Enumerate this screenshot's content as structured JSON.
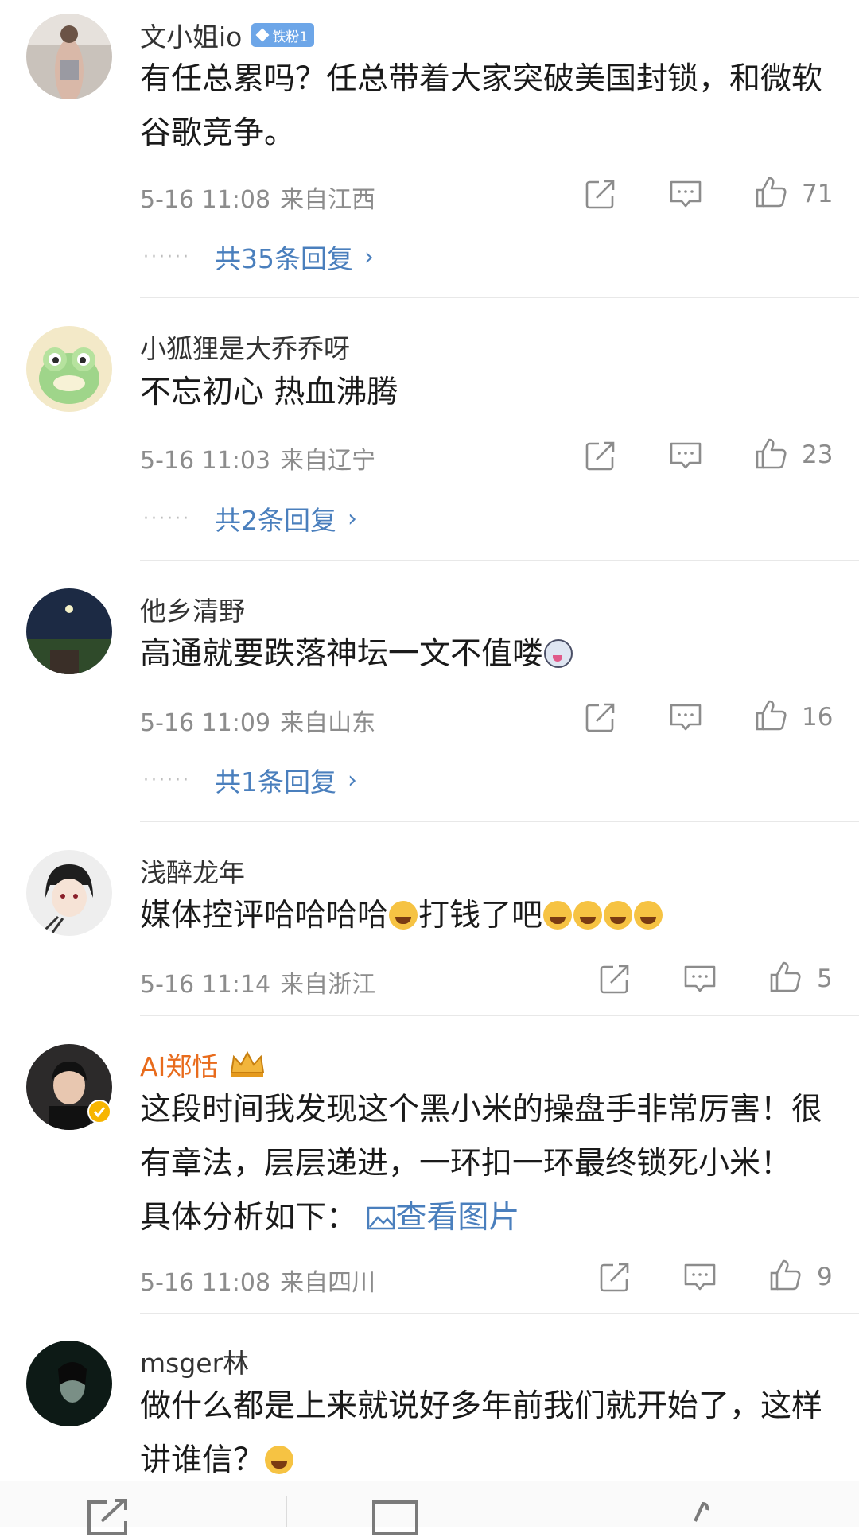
{
  "comments": [
    {
      "username": "文小姐io",
      "badge": "铁粉1",
      "text": "有任总累吗？任总带着大家突破美国封锁，和微软谷歌竞争。",
      "time": "5-16 11:08",
      "location": "来自江西",
      "likes": "71",
      "replies": "共35条回复"
    },
    {
      "username": "小狐狸是大乔乔呀",
      "text": "不忘初心 热血沸腾",
      "time": "5-16 11:03",
      "location": "来自辽宁",
      "likes": "23",
      "replies": "共2条回复"
    },
    {
      "username": "他乡清野",
      "text": "高通就要跌落神坛一文不值喽",
      "time": "5-16 11:09",
      "location": "来自山东",
      "likes": "16",
      "replies": "共1条回复"
    },
    {
      "username": "浅醉龙年",
      "text_a": "媒体控评哈哈哈哈",
      "text_b": "打钱了吧",
      "time": "5-16 11:14",
      "location": "来自浙江",
      "likes": "5"
    },
    {
      "username": "AI郑恬",
      "text": "这段时间我发现这个黑小米的操盘手非常厉害！很有章法，层层递进，一环扣一环最终锁死小米！ 具体分析如下：",
      "view_image": "查看图片",
      "time": "5-16 11:08",
      "location": "来自四川",
      "likes": "9"
    },
    {
      "username": "msger林",
      "text": "做什么都是上来就说好多年前我们就开始了，这样讲谁信？"
    }
  ],
  "colors": {
    "link": "#4a7fbd",
    "vip_name": "#e86b1c",
    "meta": "#8c8c8c",
    "badge": "#6da6e8"
  },
  "icons": [
    "share-icon",
    "comment-icon",
    "like-icon",
    "chevron-right-icon",
    "image-icon",
    "crown-icon",
    "verified-icon"
  ]
}
